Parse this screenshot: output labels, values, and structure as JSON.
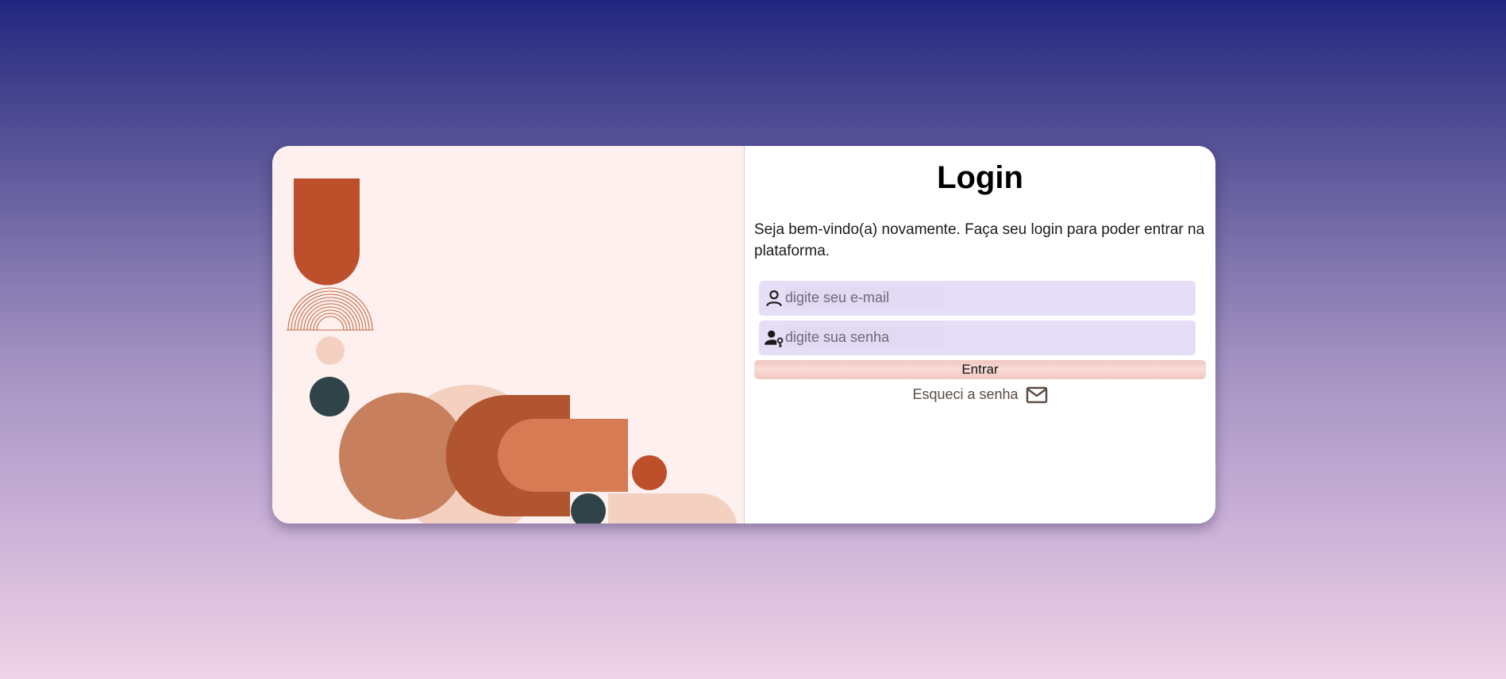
{
  "login": {
    "title": "Login",
    "welcome_text": "Seja bem-vindo(a) novamente. Faça seu login para poder entrar na plataforma.",
    "email": {
      "placeholder": "digite seu e-mail",
      "value": "",
      "icon": "user-icon"
    },
    "password": {
      "placeholder": "digite sua senha",
      "value": "",
      "icon": "user-key-icon"
    },
    "submit_label": "Entrar",
    "forgot_label": "Esqueci a senha",
    "forgot_icon": "mail-icon"
  },
  "colors": {
    "background_top": "#21267f",
    "background_bottom": "#f0d3e6",
    "art_panel_bg": "#fdf0ee",
    "field_bg": "#e6def6",
    "button_bg": "#f2c7c1",
    "rust": "#bd4f2b",
    "terracotta": "#c77f5d",
    "peach": "#f4d0c1",
    "dark_slate": "#2f4348"
  }
}
